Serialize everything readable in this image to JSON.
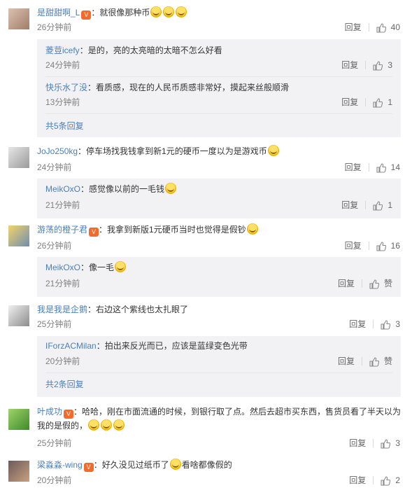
{
  "icons": {
    "like": "thumbs-up-icon",
    "emoji": "laughing-emoji-icon",
    "vip": "vip-badge-icon"
  },
  "labels": {
    "reply": "回复",
    "like_zero": "赞"
  },
  "comments": [
    {
      "user": "是甜甜啊_L",
      "text": "：就很像那种币",
      "time": "26分钟前",
      "likes": "40",
      "replies": [
        {
          "user": "菱荳icefy",
          "text": "：是的，亮的太亮暗的太暗不怎么好看",
          "time": "24分钟前",
          "likes": "3"
        },
        {
          "user": "快乐水了没",
          "text": "：看质感，现在的人民币质感非常好，摸起来丝般顺滑",
          "time": "13分钟前",
          "likes": "1"
        }
      ],
      "more": "共5条回复"
    },
    {
      "user": "JoJo250kg",
      "text": "：停车场找我钱拿到新1元的硬币一度以为是游戏币",
      "time": "24分钟前",
      "likes": "14",
      "replies": [
        {
          "user": "MeikOxO",
          "text": "：感觉像以前的一毛钱",
          "time": "21分钟前",
          "likes": "1"
        }
      ]
    },
    {
      "user": "游荡的橙子君",
      "text": "：我拿到新版1元硬币当时也觉得是假钞",
      "time": "26分钟前",
      "likes": "16",
      "replies": [
        {
          "user": "MeikOxO",
          "text": "：像一毛",
          "time": "21分钟前",
          "likes": "赞"
        }
      ]
    },
    {
      "user": "我是我是企鹅",
      "text": "：右边这个紫线也太扎眼了",
      "time": "25分钟前",
      "likes": "3",
      "replies": [
        {
          "user": "IForzACMilan",
          "text": "：拍出来反光而已，应该是蓝绿变色光带",
          "time": "20分钟前",
          "likes": "赞"
        }
      ],
      "more": "共2条回复"
    },
    {
      "user": "叶成功",
      "text": "：哈哈，刚在市面流通的时候，到银行取了点。然后去超市买东西，售货员看了半天以为我的是假的，",
      "time": "25分钟前",
      "likes": "3"
    },
    {
      "user": "梁淼淼-wing",
      "text": "：好久没见过纸币了",
      "text2": "看啥都像假的",
      "time": "20分钟前",
      "likes": "2"
    }
  ]
}
